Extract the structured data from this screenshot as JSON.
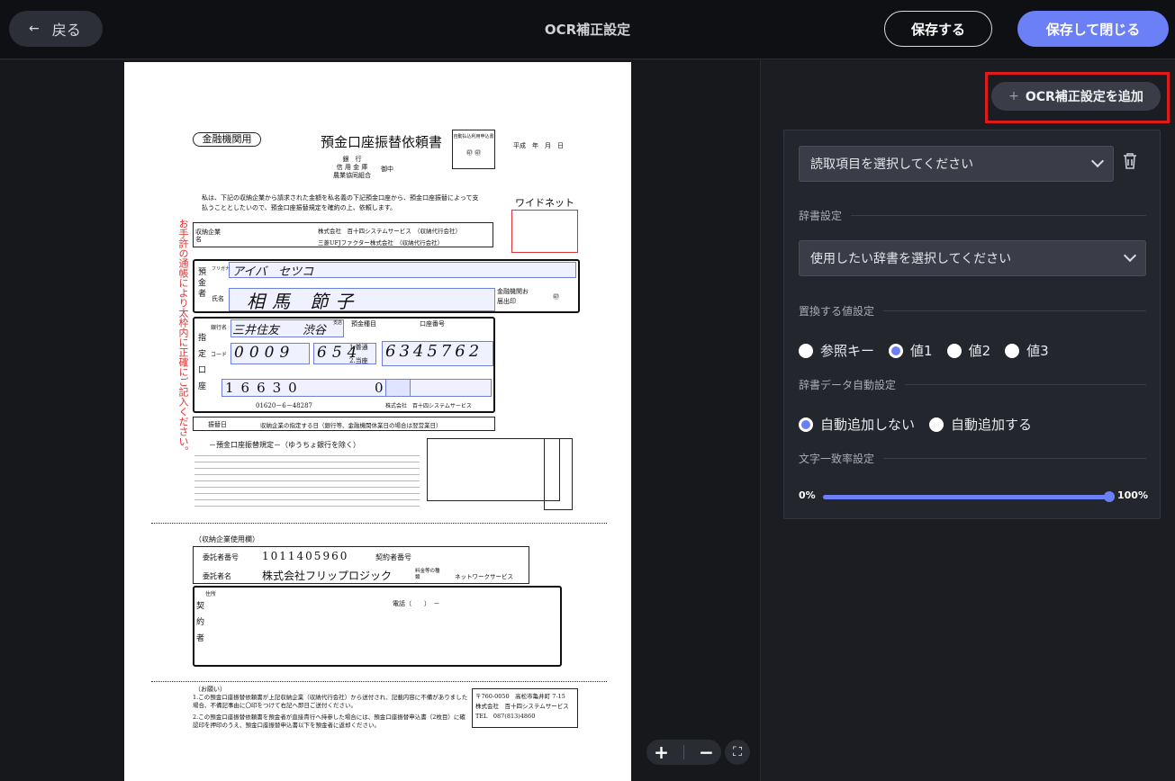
{
  "header": {
    "back_label": "戻る",
    "title": "OCR補正設定",
    "save_label": "保存する",
    "save_close_label": "保存して閉じる"
  },
  "panel": {
    "add_label": "OCR補正設定を追加",
    "read_item_placeholder": "読取項目を選択してください",
    "dictionary_section": "辞書設定",
    "dictionary_placeholder": "使用したい辞書を選択してください",
    "replace_section": "置換する値設定",
    "replace_options": [
      "参照キー",
      "値1",
      "値2",
      "値3"
    ],
    "replace_selected": 1,
    "auto_section": "辞書データ自動設定",
    "auto_options": [
      "自動追加しない",
      "自動追加する"
    ],
    "auto_selected": 0,
    "match_section": "文字一致率設定",
    "match_min": "0%",
    "match_max": "100%",
    "match_value": 100
  },
  "document": {
    "bank_tag": "金融機関用",
    "title": "預金口座振替依頼書",
    "apply_box": "自動払込利用申込書",
    "date": "平成　年　月　日",
    "bank_types": "銀　行\n信 用 金 庫\n農業協同組合",
    "onchu": "御中",
    "intro": "私は、下記の収納企業から請求された金額を私名義の下記預金口座から、預金口座振替によって支払うこととしたいので、預金口座振替規定を確約の上、依頼します。",
    "brand": "ワイドネット",
    "side_note": "お手許の通帳により太枠内に正確にご記入ください。",
    "company_label": "収納企業名",
    "company1": "株式会社　百十四システムサービス　（収納代行会社）",
    "company2": "三菱UFJファクター株式会社　（収納代行会社）",
    "kana_label": "フリガナ",
    "kana_value": "アイバ　セツコ",
    "holder_label": "預金者",
    "name_label": "氏名",
    "name_value": "相馬 節子",
    "seal_label": "金融機関お届出印",
    "bank_label": "銀行名",
    "bank_value": "三井住友",
    "branch_value": "渋谷",
    "branch_label": "支店",
    "code_label": "コード",
    "bank_code": "0009",
    "branch_code": "654",
    "type_label": "預金種目",
    "type1": "1.普通",
    "type2": "2.当座",
    "account_label": "口座番号",
    "account_value": "6345762",
    "designated_label": "指定口座",
    "passbook_code": "16630",
    "passbook_num": "0",
    "payee": "01620－6－48287",
    "payee_company": "株式会社　百十四システムサービス",
    "transfer_label": "振替日",
    "transfer_text": "収納企業の指定する日（銀行等、金融機関休業日の場合は翌営業日）",
    "rules_title": "－預金口座振替規定－（ゆうちょ銀行を除く）",
    "usage_label": "（収納企業使用欄）",
    "consignor_num_label": "委託者番号",
    "consignor_num": "1011405960",
    "contract_label": "契約者番号",
    "consignor_name_label": "委託者名",
    "consignor_name": "株式会社フリップロジック",
    "fee_label": "料金等の種類",
    "fee_value": "ネットワークサービス",
    "address_label": "住所",
    "phone_label": "電話（　　）　－",
    "contractor_label": "契約者",
    "request_title": "（お願い）",
    "request1": "1.この預金口座振替依頼書が上記収納企業（収納代行会社）から送付され、記載内容に不備がありました場合、不備記事由に〇印をつけて右記へ即日ご送付ください。",
    "request2": "2.この預金口座振替依頼書を預金者が直接貴行へ持参した場合には、預金口座振替申込書（2枚目）に確認印を押印のうえ、預金口座振替申込書以下を預金者に返却ください。",
    "address_box": "〒760-0050　高松市亀井町 7-15\n株式会社　百十四システムサービス\nTEL　087(813)4860"
  }
}
